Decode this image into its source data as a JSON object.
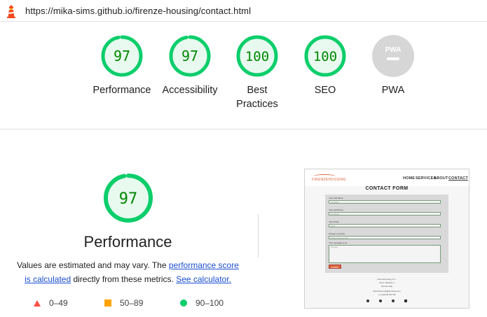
{
  "browser": {
    "url": "https://mika-sims.github.io/firenze-housing/contact.html",
    "logo_icon": "lighthouse-icon"
  },
  "colors": {
    "pass": "#0cce6b",
    "pass_text": "#008800",
    "pass_fill": "#e8f9ef",
    "average": "#ffa400",
    "fail": "#ff4e42",
    "pwa_gray": "#cccccc",
    "link": "#1a4fd1"
  },
  "summary": {
    "gauges": [
      {
        "score": "97",
        "label": "Performance",
        "level": 0.97
      },
      {
        "score": "97",
        "label": "Accessibility",
        "level": 0.97
      },
      {
        "score": "100",
        "label": "Best Practices",
        "level": 1.0
      },
      {
        "score": "100",
        "label": "SEO",
        "level": 1.0
      }
    ],
    "pwa": {
      "badge": "PWA",
      "label": "PWA"
    }
  },
  "performance": {
    "score": "97",
    "level": 0.97,
    "title": "Performance",
    "note_before": "Values are estimated and may vary. The ",
    "note_link_1": "performance score is calculated",
    "note_middle": " directly from these metrics. ",
    "note_link_2": "See calculator."
  },
  "legend": {
    "fail": "0–49",
    "average": "50–89",
    "pass": "90–100"
  },
  "screenshot": {
    "brand": "FIRENZEHOUSING",
    "nav": [
      "HOME",
      "SERVICES",
      "ABOUT",
      "CONTACT"
    ],
    "form_title": "CONTACT FORM",
    "fields": [
      {
        "label": "Your Full Name",
        "placeholder": "Full Name"
      },
      {
        "label": "Your cell Phone",
        "placeholder": "Cell Phone"
      },
      {
        "label": "Your Email",
        "placeholder": "Email"
      },
      {
        "label": "Choose a service",
        "placeholder": "Please choose service"
      }
    ],
    "message_label": "Your message to us",
    "message_placeholder": "Message",
    "submit": "SUBMIT",
    "footer_lines": [
      "Firenzehousing S.r.l.",
      "Via D. Michele 1",
      "Firenze Italy",
      "firenzehousing@housing.com",
      "+1 (0)1234 567 99"
    ]
  }
}
